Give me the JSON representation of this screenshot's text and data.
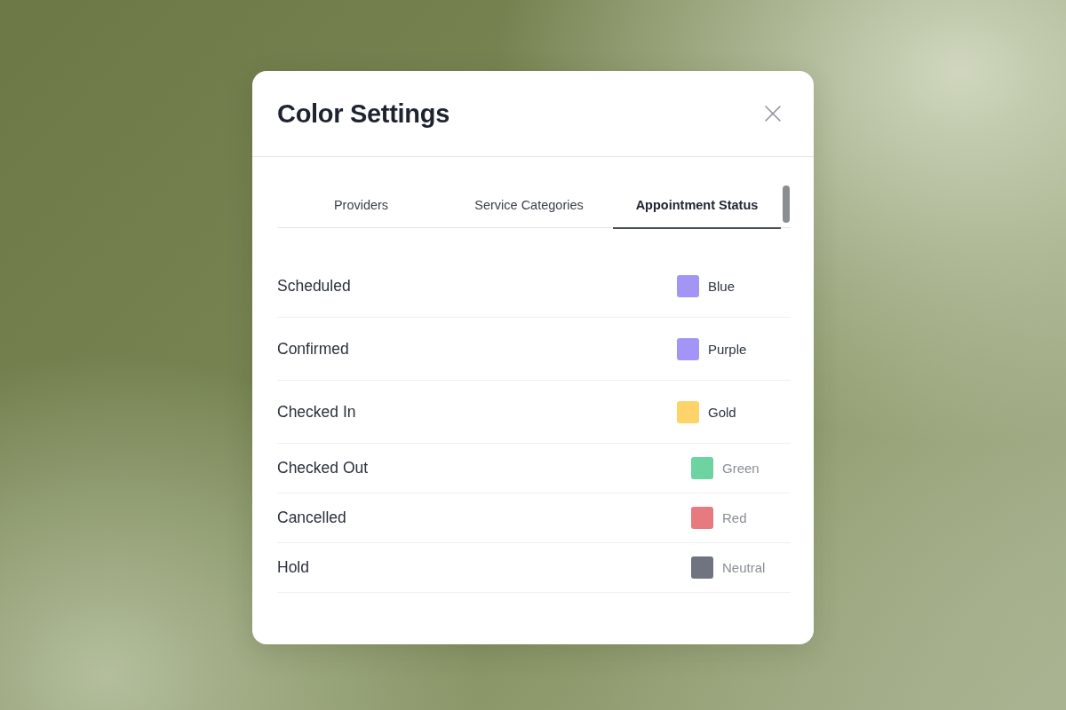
{
  "dialog": {
    "title": "Color Settings"
  },
  "tabs": [
    {
      "label": "Providers",
      "selected": false
    },
    {
      "label": "Service Categories",
      "selected": false
    },
    {
      "label": "Appointment Status",
      "selected": true
    }
  ],
  "statuses": [
    {
      "name": "Scheduled",
      "kind": "standard",
      "color": "#a395f5",
      "color_name": "Blue"
    },
    {
      "name": "Confirmed",
      "kind": "standard",
      "color": "#a395f5",
      "color_name": "Purple"
    },
    {
      "name": "Checked In",
      "kind": "standard",
      "color": "#fdd36a",
      "color_name": "Gold"
    },
    {
      "name": "Checked Out",
      "kind": "compact",
      "color": "#6dd3a0",
      "color_name": "Green"
    },
    {
      "name": "Cancelled",
      "kind": "compact",
      "color": "#e77a7e",
      "color_name": "Red"
    },
    {
      "name": "Hold",
      "kind": "compact",
      "color": "#6f7480",
      "color_name": "Neutral"
    }
  ]
}
